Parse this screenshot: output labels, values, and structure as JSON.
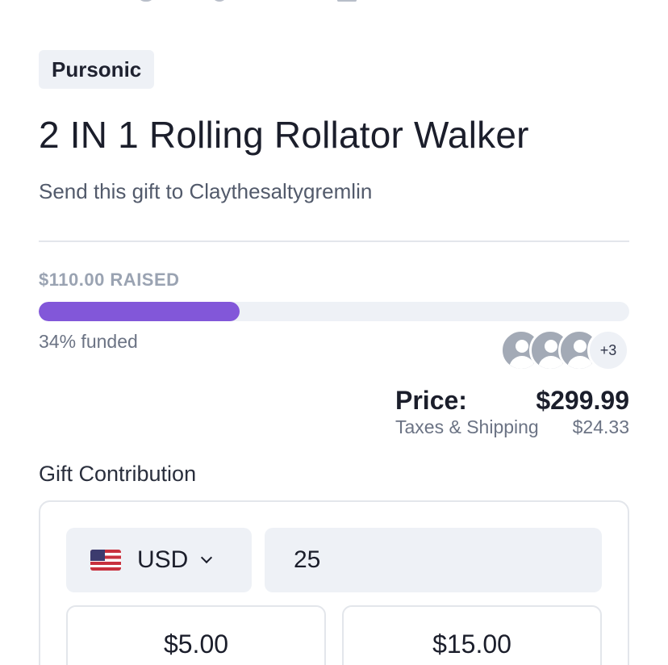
{
  "product": {
    "brand": "Pursonic",
    "title": "2 IN 1 Rolling Rollator Walker",
    "subtitle": "Send this gift to Claythesaltygremlin"
  },
  "funding": {
    "raised_text": "$110.00 RAISED",
    "funded_text": "34% funded",
    "progress_fraction": 0.34,
    "accent_color": "#8257d9",
    "contributors_extra": "+3"
  },
  "pricing": {
    "price_label": "Price:",
    "price_value": "$299.99",
    "tax_label": "Taxes & Shipping",
    "tax_value": "$24.33"
  },
  "contribution": {
    "section_title": "Gift Contribution",
    "currency_flag_icon": "us-flag-icon",
    "currency_code": "USD",
    "amount_value": "25",
    "presets": [
      "$5.00",
      "$15.00"
    ]
  }
}
